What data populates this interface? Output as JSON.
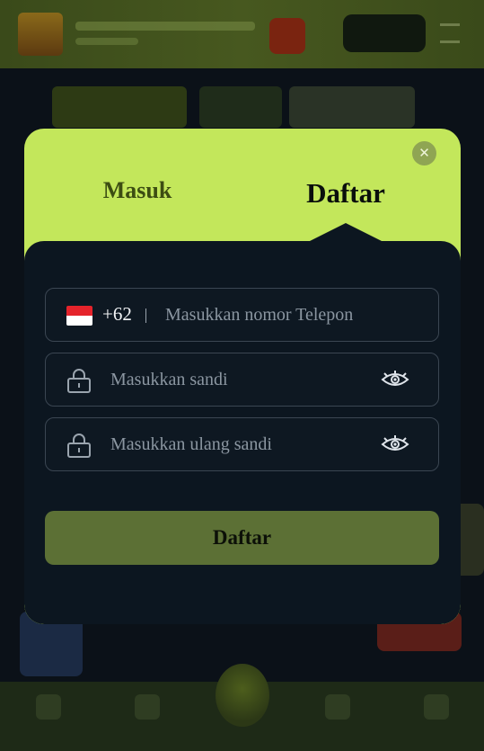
{
  "modal": {
    "tabs": {
      "login_label": "Masuk",
      "register_label": "Daftar",
      "active": "register"
    },
    "phone": {
      "country": "Indonesia",
      "dial_code": "+62",
      "placeholder": "Masukkan nomor Telepon",
      "value": ""
    },
    "password": {
      "placeholder": "Masukkan sandi",
      "value": ""
    },
    "confirm_password": {
      "placeholder": "Masukkan ulang sandi",
      "value": ""
    },
    "submit_label": "Daftar"
  },
  "colors": {
    "modal_accent": "#c3e75b",
    "form_background": "#0c1620",
    "submit_button": "#5c7035",
    "page_background": "#0b1118"
  },
  "icons": {
    "close": "close-icon",
    "flag": "indonesia-flag-icon",
    "lock": "lock-icon",
    "eye": "eye-icon"
  }
}
